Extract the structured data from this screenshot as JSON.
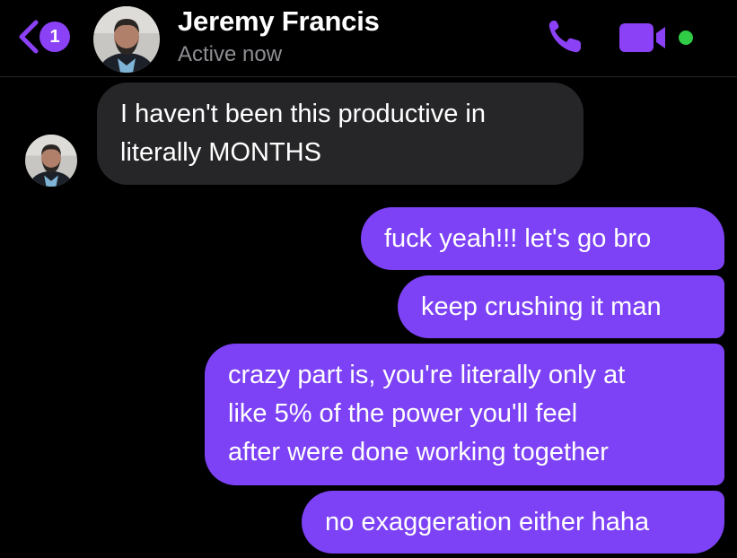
{
  "header": {
    "unread_count": "1",
    "contact_name": "Jeremy Francis",
    "status": "Active now",
    "back_icon": "chevron-left-icon",
    "call_icon": "phone-icon",
    "video_icon": "video-camera-icon",
    "accent_color": "#8b41f6",
    "active_color": "#31cc46"
  },
  "messages": [
    {
      "direction": "incoming",
      "lines": [
        "I haven't been this productive in",
        "literally MONTHS"
      ]
    },
    {
      "direction": "outgoing",
      "lines": [
        "fuck yeah!!! let's go bro"
      ]
    },
    {
      "direction": "outgoing",
      "lines": [
        "keep crushing it man"
      ]
    },
    {
      "direction": "outgoing",
      "lines": [
        "crazy part is, you're literally only at",
        "like 5% of the power you'll feel",
        "after were done working together"
      ]
    },
    {
      "direction": "outgoing",
      "lines": [
        "no exaggeration either haha"
      ]
    }
  ],
  "colors": {
    "incoming_bubble": "#262628",
    "outgoing_bubble": "#7d42f5",
    "background": "#000000"
  }
}
